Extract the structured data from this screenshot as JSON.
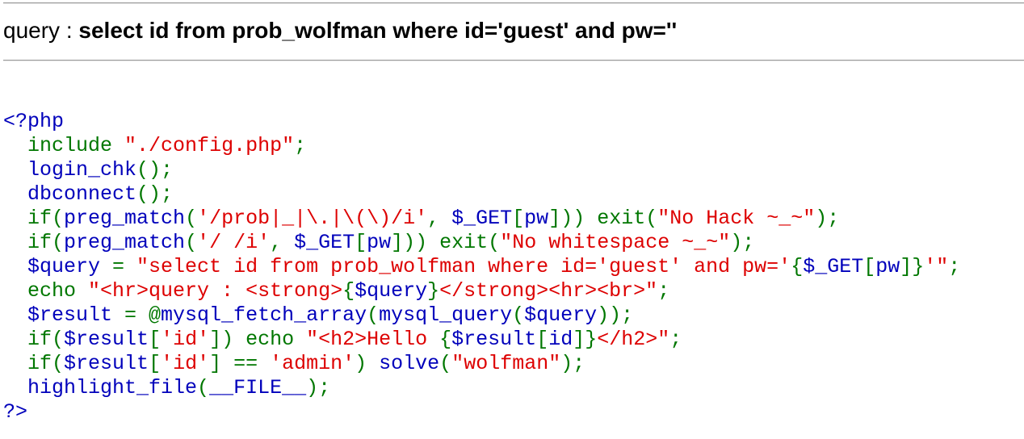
{
  "header": {
    "query_label": "query : ",
    "query_text": "select id from prob_wolfman where id='guest' and pw=''"
  },
  "code": {
    "lines": [
      [
        {
          "t": "<?php",
          "c": "v"
        }
      ],
      [
        {
          "t": "  ",
          "c": "v"
        },
        {
          "t": "include ",
          "c": "k"
        },
        {
          "t": "\"./config.php\"",
          "c": "s"
        },
        {
          "t": ";",
          "c": "k"
        }
      ],
      [
        {
          "t": "  login_chk",
          "c": "v"
        },
        {
          "t": "();",
          "c": "k"
        }
      ],
      [
        {
          "t": "  dbconnect",
          "c": "v"
        },
        {
          "t": "();",
          "c": "k"
        }
      ],
      [
        {
          "t": "  ",
          "c": "v"
        },
        {
          "t": "if(",
          "c": "k"
        },
        {
          "t": "preg_match",
          "c": "v"
        },
        {
          "t": "(",
          "c": "k"
        },
        {
          "t": "'/prob|_|\\.|\\(\\)/i'",
          "c": "s"
        },
        {
          "t": ", ",
          "c": "k"
        },
        {
          "t": "$_GET",
          "c": "v"
        },
        {
          "t": "[",
          "c": "k"
        },
        {
          "t": "pw",
          "c": "v"
        },
        {
          "t": "])) exit(",
          "c": "k"
        },
        {
          "t": "\"No Hack ~_~\"",
          "c": "s"
        },
        {
          "t": ");",
          "c": "k"
        }
      ],
      [
        {
          "t": "  ",
          "c": "v"
        },
        {
          "t": "if(",
          "c": "k"
        },
        {
          "t": "preg_match",
          "c": "v"
        },
        {
          "t": "(",
          "c": "k"
        },
        {
          "t": "'/ /i'",
          "c": "s"
        },
        {
          "t": ", ",
          "c": "k"
        },
        {
          "t": "$_GET",
          "c": "v"
        },
        {
          "t": "[",
          "c": "k"
        },
        {
          "t": "pw",
          "c": "v"
        },
        {
          "t": "])) exit(",
          "c": "k"
        },
        {
          "t": "\"No whitespace ~_~\"",
          "c": "s"
        },
        {
          "t": ");",
          "c": "k"
        }
      ],
      [
        {
          "t": "  $query ",
          "c": "v"
        },
        {
          "t": "= ",
          "c": "k"
        },
        {
          "t": "\"select id from prob_wolfman where id='guest' and pw='",
          "c": "s"
        },
        {
          "t": "{",
          "c": "k"
        },
        {
          "t": "$_GET",
          "c": "v"
        },
        {
          "t": "[",
          "c": "k"
        },
        {
          "t": "pw",
          "c": "v"
        },
        {
          "t": "]}",
          "c": "k"
        },
        {
          "t": "'\"",
          "c": "s"
        },
        {
          "t": ";",
          "c": "k"
        }
      ],
      [
        {
          "t": "  ",
          "c": "v"
        },
        {
          "t": "echo ",
          "c": "k"
        },
        {
          "t": "\"<hr>query : <strong>",
          "c": "s"
        },
        {
          "t": "{",
          "c": "k"
        },
        {
          "t": "$query",
          "c": "v"
        },
        {
          "t": "}",
          "c": "k"
        },
        {
          "t": "</strong><hr><br>\"",
          "c": "s"
        },
        {
          "t": ";",
          "c": "k"
        }
      ],
      [
        {
          "t": "  $result ",
          "c": "v"
        },
        {
          "t": "= @",
          "c": "k"
        },
        {
          "t": "mysql_fetch_array",
          "c": "v"
        },
        {
          "t": "(",
          "c": "k"
        },
        {
          "t": "mysql_query",
          "c": "v"
        },
        {
          "t": "(",
          "c": "k"
        },
        {
          "t": "$query",
          "c": "v"
        },
        {
          "t": "));",
          "c": "k"
        }
      ],
      [
        {
          "t": "  ",
          "c": "v"
        },
        {
          "t": "if(",
          "c": "k"
        },
        {
          "t": "$result",
          "c": "v"
        },
        {
          "t": "[",
          "c": "k"
        },
        {
          "t": "'id'",
          "c": "s"
        },
        {
          "t": "]) echo ",
          "c": "k"
        },
        {
          "t": "\"<h2>Hello ",
          "c": "s"
        },
        {
          "t": "{",
          "c": "k"
        },
        {
          "t": "$result",
          "c": "v"
        },
        {
          "t": "[",
          "c": "k"
        },
        {
          "t": "id",
          "c": "v"
        },
        {
          "t": "]}",
          "c": "k"
        },
        {
          "t": "</h2>\"",
          "c": "s"
        },
        {
          "t": ";",
          "c": "k"
        }
      ],
      [
        {
          "t": "  ",
          "c": "v"
        },
        {
          "t": "if(",
          "c": "k"
        },
        {
          "t": "$result",
          "c": "v"
        },
        {
          "t": "[",
          "c": "k"
        },
        {
          "t": "'id'",
          "c": "s"
        },
        {
          "t": "] == ",
          "c": "k"
        },
        {
          "t": "'admin'",
          "c": "s"
        },
        {
          "t": ") ",
          "c": "k"
        },
        {
          "t": "solve",
          "c": "v"
        },
        {
          "t": "(",
          "c": "k"
        },
        {
          "t": "\"wolfman\"",
          "c": "s"
        },
        {
          "t": ");",
          "c": "k"
        }
      ],
      [
        {
          "t": "  highlight_file",
          "c": "v"
        },
        {
          "t": "(",
          "c": "k"
        },
        {
          "t": "__FILE__",
          "c": "v"
        },
        {
          "t": ");",
          "c": "k"
        }
      ],
      [
        {
          "t": "?>",
          "c": "v"
        }
      ]
    ]
  }
}
